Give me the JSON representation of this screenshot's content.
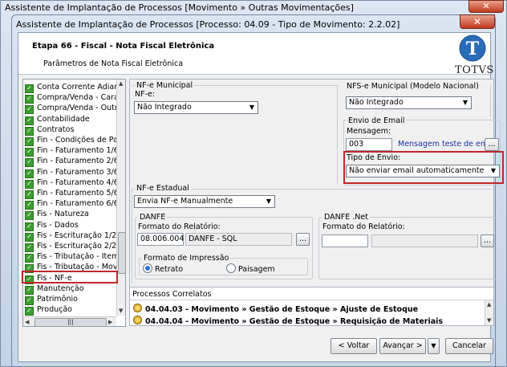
{
  "outer_window": {
    "title": "Assistente de Implantação de Processos [Movimento » Outras Movimentações]",
    "close_label": "✕"
  },
  "dialog": {
    "title": "Assistente de Implantação de Processos [Processo: 04.09 - Tipo de Movimento: 2.2.02]",
    "close_label": "✕",
    "step_title": "Etapa 66 - Fiscal - Nota Fiscal Eletrônica",
    "step_subtitle": "Parâmetros de Nota Fiscal Eletrônica",
    "logo_text": "TOTVS",
    "logo_letter": "T"
  },
  "tree": {
    "items": [
      {
        "label": "Conta Corrente Adianta",
        "checked": true
      },
      {
        "label": "Compra/Venda - Caracte",
        "checked": true
      },
      {
        "label": "Compra/Venda - Outros",
        "checked": true
      },
      {
        "label": "Contabilidade",
        "checked": true
      },
      {
        "label": "Contratos",
        "checked": true
      },
      {
        "label": "Fin - Condições de Paga",
        "checked": true
      },
      {
        "label": "Fin - Faturamento 1/6",
        "checked": true
      },
      {
        "label": "Fin - Faturamento 2/6",
        "checked": true
      },
      {
        "label": "Fin - Faturamento 3/6",
        "checked": true
      },
      {
        "label": "Fin - Faturamento 4/6",
        "checked": true
      },
      {
        "label": "Fin - Faturamento 5/6",
        "checked": true
      },
      {
        "label": "Fin - Faturamento 6/6",
        "checked": true
      },
      {
        "label": "Fis - Natureza",
        "checked": true
      },
      {
        "label": "Fis - Dados",
        "checked": true
      },
      {
        "label": "Fis - Escrituração 1/2",
        "checked": true
      },
      {
        "label": "Fis - Escrituração 2/2",
        "checked": true
      },
      {
        "label": "Fis - Tributação - Item",
        "checked": true
      },
      {
        "label": "Fis - Tributação - Movim",
        "checked": true
      },
      {
        "label": "Fis - NF-e",
        "checked": true
      },
      {
        "label": "Manutenção",
        "checked": true
      },
      {
        "label": "Patrimônio",
        "checked": true
      },
      {
        "label": "Produção",
        "checked": true
      }
    ],
    "hscroll_thumb": "|||"
  },
  "nfe_municipal": {
    "group_label": "NF-e Municipal",
    "field_label": "NF-e:",
    "value": "Não Integrado"
  },
  "nfse_nacional": {
    "group_label": "NFS-e Municipal (Modelo Nacional)",
    "value": "Não Integrado"
  },
  "envio_email": {
    "group_label": "Envio de Email",
    "mensagem_label": "Mensagem:",
    "mensagem_code": "003",
    "mensagem_desc": "Mensagem teste de envio",
    "browse_label": "...",
    "tipo_envio_label": "Tipo de Envio:",
    "tipo_envio_value": "Não enviar email automaticamente"
  },
  "nfe_estadual": {
    "group_label": "NF-e Estadual",
    "value": "Envia NF-e Manualmente",
    "danfe": {
      "group_label": "DANFE",
      "formato_label": "Formato do Relatório:",
      "code": "08.006.004",
      "desc": "DANFE - SQL",
      "browse_label": "...",
      "impressao_label": "Formato de Impressão",
      "option_retrato": "Retrato",
      "option_paisagem": "Paisagem",
      "selected": "Retrato"
    },
    "danfe_net": {
      "group_label": "DANFE .Net",
      "formato_label": "Formato do Relatório:",
      "code": "",
      "desc": "",
      "browse_label": "..."
    }
  },
  "processos": {
    "title": "Processos Correlatos",
    "rows": [
      "04.04.03 - Movimento » Gestão de Estoque » Ajuste de Estoque",
      "04.04.04 - Movimento » Gestão de Estoque » Requisição de Materiais"
    ]
  },
  "buttons": {
    "back": "< Voltar",
    "next": "Avançar >",
    "next_menu": "▼",
    "cancel": "Cancelar"
  },
  "colors": {
    "highlight": "#c0282a",
    "check": "#3b9e2f",
    "link": "#1a2fb0"
  }
}
